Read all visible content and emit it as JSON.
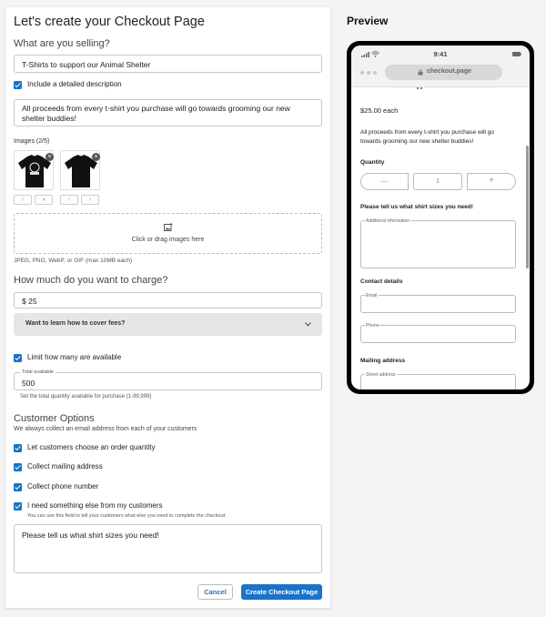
{
  "form": {
    "title": "Let's create your Checkout Page",
    "selling_heading": "What are you selling?",
    "product_name": "T-Shirts to support our Animal Shelter",
    "include_description_label": "Include a detailed description",
    "description": "All proceeds from every t-shirt you purchase will go towards grooming our new shelter buddies!",
    "images_label": "Images (2/5)",
    "upload_text": "Click or drag images here",
    "upload_hint": "JPEG, PNG, WebP, or GIF (max 10MB each)",
    "charge_heading": "How much do you want to charge?",
    "price": "$ 25",
    "fees_label": "Want to learn how to cover fees?",
    "limit_label": "Limit how many are available",
    "total_label": "Total available",
    "total_value": "500",
    "total_hint": "Set the total quantity available for purchase (1-99,999)",
    "customer_heading": "Customer Options",
    "customer_sub": "We always collect an email address from each of your customers",
    "opt_quantity": "Let customers choose an order quantity",
    "opt_mailing": "Collect mailing address",
    "opt_phone": "Collect phone number",
    "opt_else": "I need something else from my customers",
    "opt_else_hint": "You can use this field to tell your customers what else you need to complete the checkout.",
    "else_text": "Please tell us what shirt sizes you need!",
    "cancel": "Cancel",
    "create": "Create Checkout Page"
  },
  "preview": {
    "heading": "Preview",
    "time": "9:41",
    "url": "checkout.page",
    "price": "$25.00 each",
    "description": "All proceeds from every t-shirt you purchase will go towards grooming our new shelter buddies!",
    "quantity_label": "Quantity",
    "quantity_value": "1",
    "minus": "—",
    "plus": "+",
    "question": "Please tell us what shirt sizes you need!",
    "additional_label": "Additional information",
    "contact_label": "Contact details",
    "email_label": "Email",
    "phone_label": "Phone",
    "mailing_label": "Mailing address",
    "street_label": "Street address"
  },
  "colors": {
    "accent": "#1a73c8",
    "fees_bg": "#e6e6e9"
  }
}
